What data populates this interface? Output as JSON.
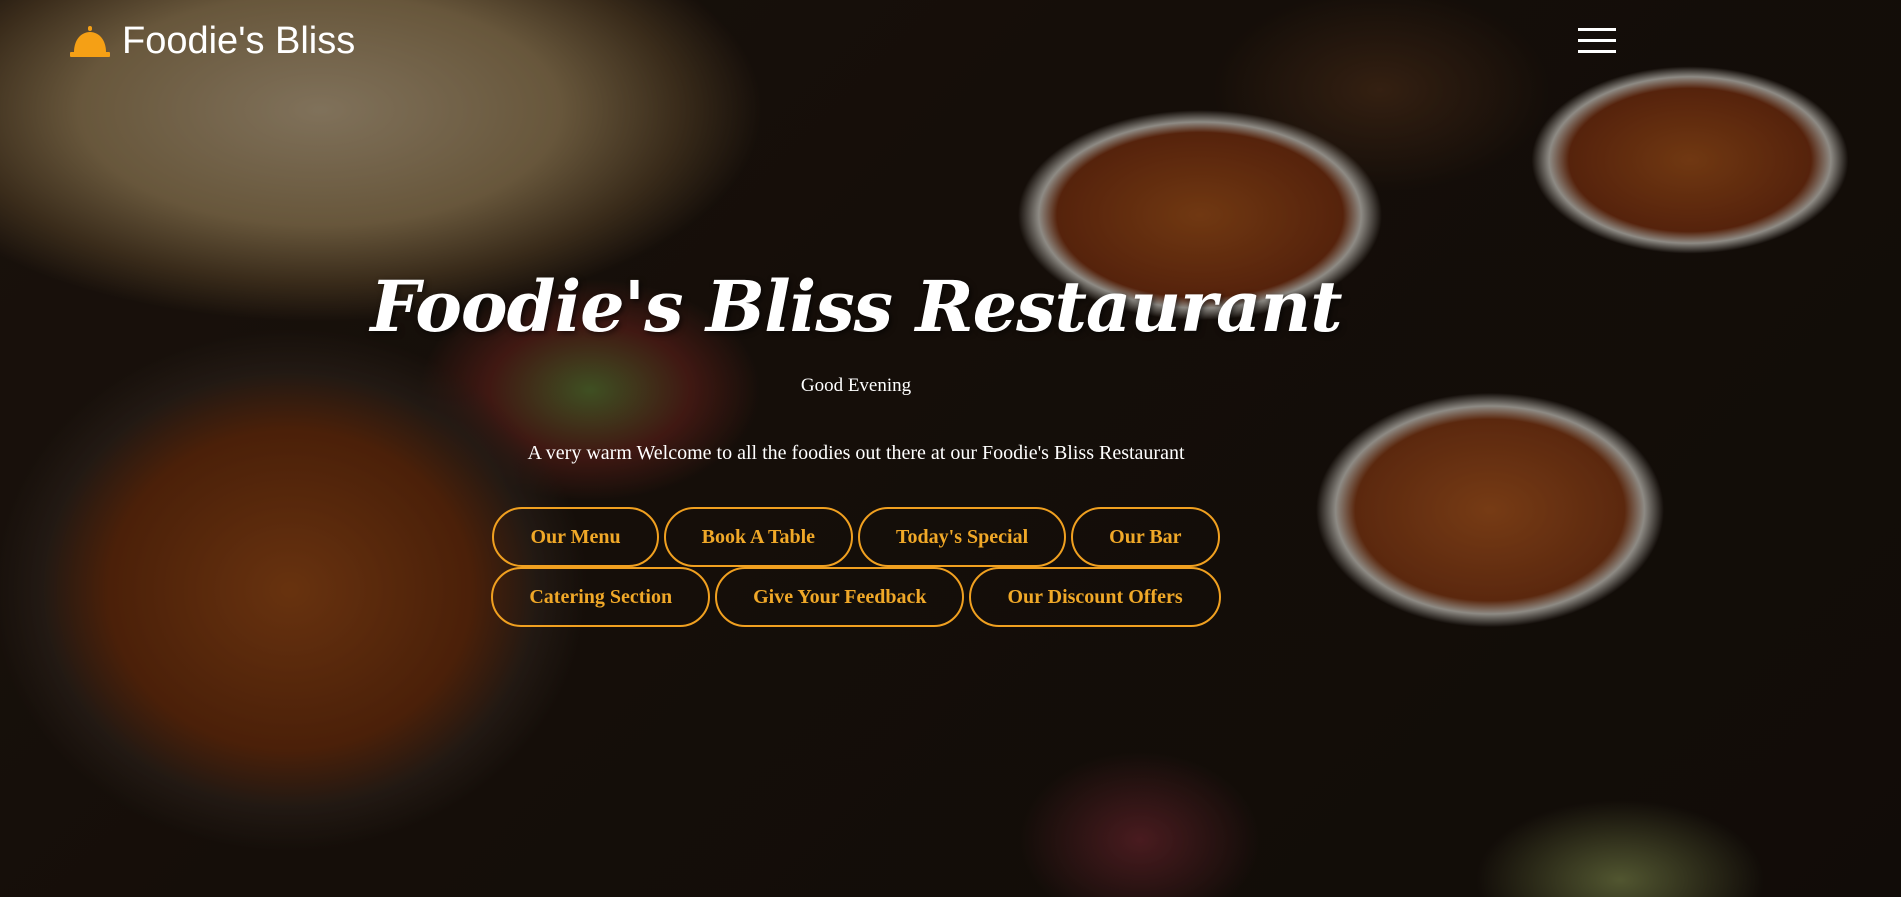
{
  "navbar": {
    "brand_name": "Foodie's Bliss",
    "brand_icon": "bell-icon",
    "menu_icon": "hamburger-menu-icon"
  },
  "hero": {
    "title": "Foodie's Bliss Restaurant",
    "greeting": "Good Evening",
    "welcome": "A very warm Welcome to all the foodies out there at our Foodie's Bliss Restaurant"
  },
  "buttons": {
    "row1": [
      "Our Menu",
      "Book A Table",
      "Today's Special",
      "Our Bar"
    ],
    "row2": [
      "Catering Section",
      "Give Your Feedback",
      "Our Discount Offers"
    ]
  },
  "colors": {
    "accent": "#f0a020",
    "text": "#ffffff"
  }
}
